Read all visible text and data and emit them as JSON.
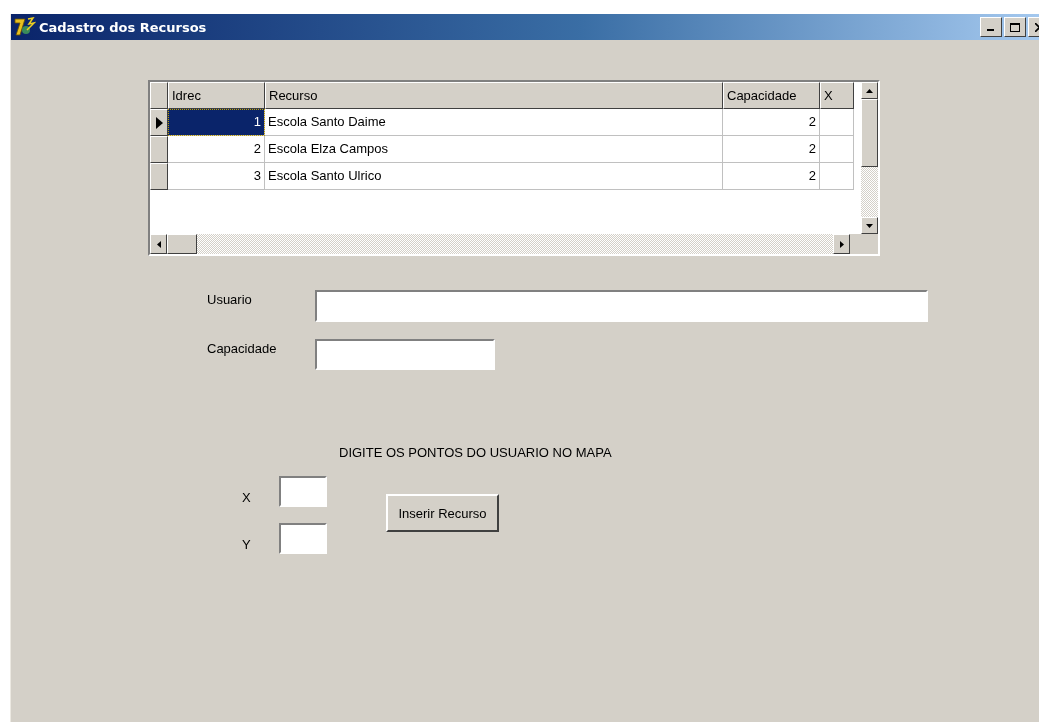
{
  "window": {
    "title": "Cadastro dos Recursos"
  },
  "grid": {
    "columns": [
      {
        "label": "Idrec",
        "kind": "number"
      },
      {
        "label": "Recurso",
        "kind": "text"
      },
      {
        "label": "Capacidade",
        "kind": "number"
      },
      {
        "label": "X",
        "kind": "text"
      }
    ],
    "rows": [
      {
        "selected": true,
        "cells": [
          "1",
          "Escola Santo Daime",
          "2",
          ""
        ]
      },
      {
        "selected": false,
        "cells": [
          "2",
          "Escola Elza Campos",
          "2",
          ""
        ]
      },
      {
        "selected": false,
        "cells": [
          "3",
          "Escola Santo Ulrico",
          "2",
          ""
        ]
      }
    ]
  },
  "fields": [
    {
      "label": "Usuario",
      "kind": "wide"
    },
    {
      "label": "Capacidade",
      "kind": "short"
    }
  ],
  "instruction": "DIGITE OS PONTOS DO USUARIO NO MAPA",
  "coords": [
    {
      "label": "X"
    },
    {
      "label": "Y"
    }
  ],
  "button": "Inserir Recurso"
}
